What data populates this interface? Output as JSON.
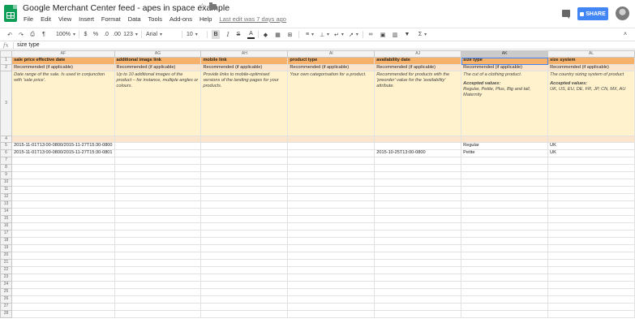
{
  "app": {
    "doc_title": "Google Merchant Center feed - apes in space example",
    "last_edit": "Last edit was 7 days ago",
    "share_label": "SHARE",
    "menu": [
      "File",
      "Edit",
      "View",
      "Insert",
      "Format",
      "Data",
      "Tools",
      "Add-ons",
      "Help"
    ]
  },
  "toolbar": {
    "zoom": "100%",
    "currency": "$",
    "percent": "%",
    "decimal_less": ".0",
    "decimal_more": ".00",
    "more_formats": "123",
    "font": "Arial",
    "font_size": "10",
    "bold": "B",
    "italic": "I",
    "strikethrough": "S",
    "text_color": "A"
  },
  "formula_bar": {
    "label": "fx",
    "value": "size type"
  },
  "grid": {
    "columns": [
      "AF",
      "AG",
      "AH",
      "AI",
      "AJ",
      "AK",
      "AL"
    ],
    "selected_column": "AK",
    "headers": [
      "sale price effective date",
      "additional image link",
      "mobile link",
      "product type",
      "availability date",
      "size type",
      "size system"
    ],
    "requirement": [
      "Recommended (if applicable)",
      "Recommended (if applicable)",
      "Recommended (if applicable)",
      "Recommended (if applicable)",
      "Recommended (if applicable)",
      "Recommended (if applicable)",
      "Recommended (if applicable)"
    ],
    "descriptions": [
      "Date range of the sale. Is used in conjunction with 'sale price'.",
      "Up to 10 additional images of the product – for instance, multiple angles or colours.",
      "Provide links to mobile-optimised versions of the landing pages for your products.",
      "Your own categorisation for a product.",
      "Recommended for products with the 'preorder' value for the 'availability' attribute.",
      "The cut of a clothing product.",
      "The country sizing system of product"
    ],
    "accepted_label": "Accepted values:",
    "accepted_values": {
      "AK": "Regular, Petite, Plus, Big and tall, Maternity",
      "AL": "UK, US, EU, DE, FR, JP, CN, MX, AU"
    },
    "data_rows": [
      {
        "row": "5",
        "cells": [
          "2015-11-01T13:00-0800/2015-11-27T15:30-0800",
          "",
          "",
          "",
          "",
          "Regular",
          "UK"
        ]
      },
      {
        "row": "6",
        "cells": [
          "2015-11-01T13:00-0800/2015-11-27T15:30-0801",
          "",
          "",
          "",
          "2015-10-25T13:00-0800",
          "Petite",
          "UK"
        ]
      }
    ],
    "row_numbers": [
      "1",
      "2",
      "3",
      "4",
      "5",
      "6",
      "7",
      "8",
      "9",
      "10",
      "11",
      "12",
      "13",
      "14",
      "15",
      "16",
      "17",
      "18",
      "19",
      "20",
      "21",
      "22",
      "23",
      "24",
      "25",
      "26",
      "27",
      "28"
    ]
  },
  "colors": {
    "header_row": "#f6b26b",
    "requirement_row": "#fce5cd",
    "description_row": "#fff2cc",
    "share_button": "#4285f4",
    "sheets_logo": "#0f9d58"
  }
}
